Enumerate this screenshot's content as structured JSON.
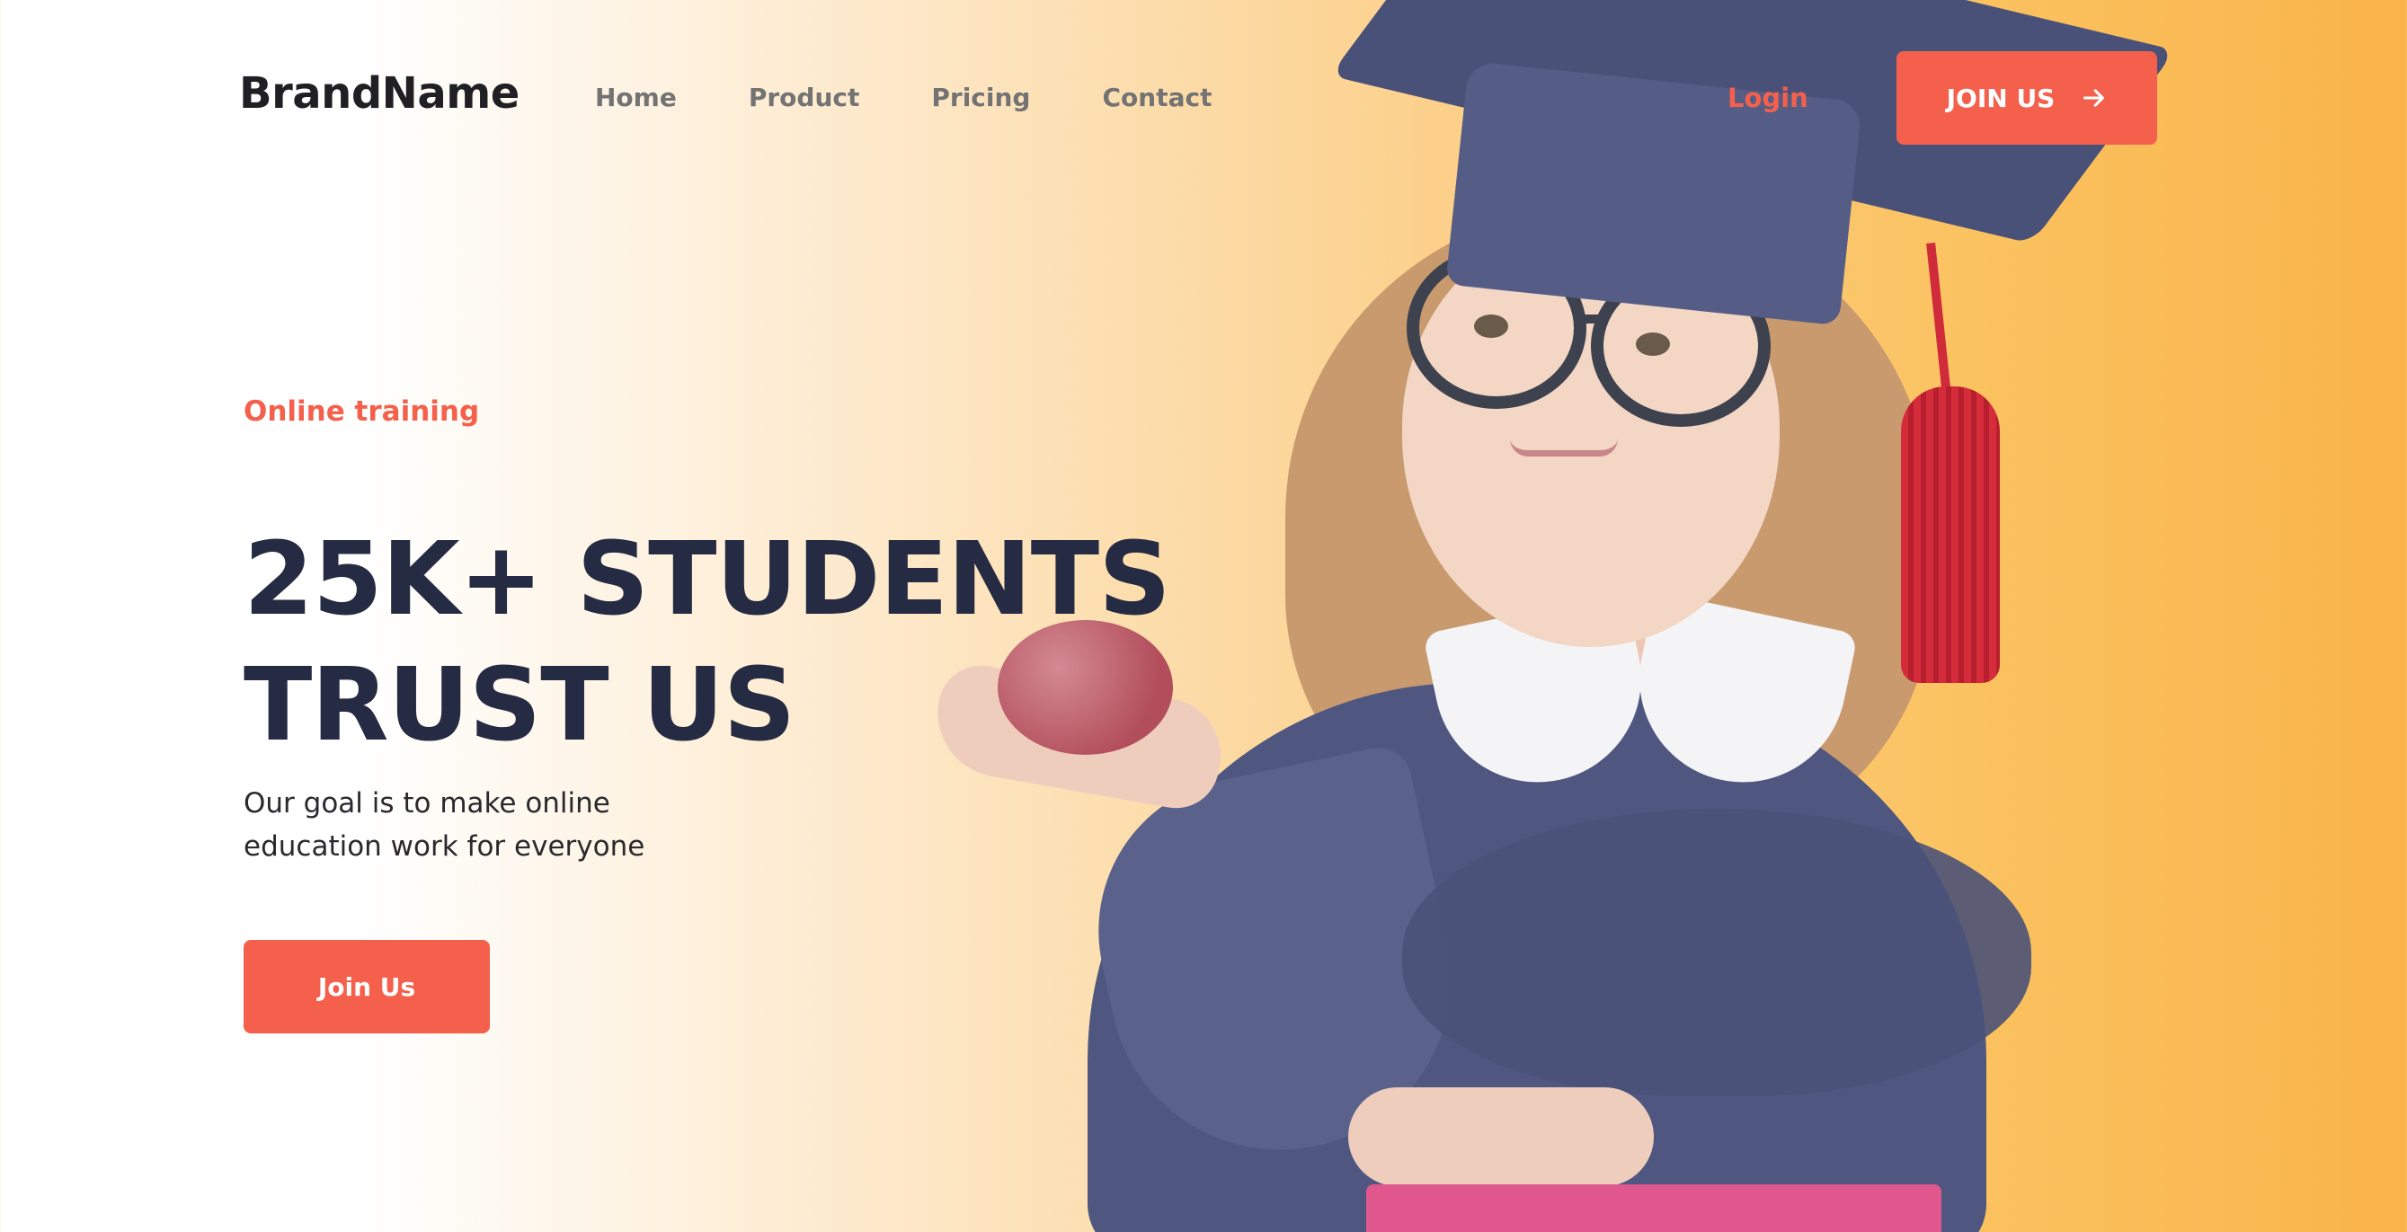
{
  "brand": {
    "name": "BrandName"
  },
  "nav": {
    "links": [
      "Home",
      "Product",
      "Pricing",
      "Contact"
    ]
  },
  "header_actions": {
    "login_label": "Login",
    "join_label": "JOIN US",
    "join_icon": "arrow-right-icon"
  },
  "hero": {
    "eyebrow": "Online training",
    "headline_line1": "25K+ STUDENTS",
    "headline_line2": "TRUST US",
    "subtext_line1": "Our goal is to make online",
    "subtext_line2": "education work for everyone",
    "cta_label": "Join Us",
    "image_subject": "girl-in-graduation-cap-holding-apple"
  },
  "colors": {
    "accent": "#F4604B",
    "headline": "#252B42",
    "nav_text": "#737373",
    "gradient_end": "#F9B34A"
  }
}
